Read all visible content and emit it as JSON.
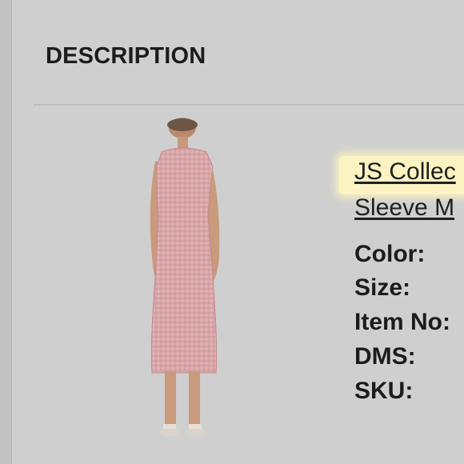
{
  "section": {
    "title": "DESCRIPTION"
  },
  "product": {
    "title_line1": "JS Collec",
    "title_line2": "Sleeve M",
    "image_alt": "pink sequin midi dress on model"
  },
  "attributes": {
    "color_label": "Color:",
    "size_label": "Size:",
    "item_no_label": "Item No:",
    "dms_label": "DMS:",
    "sku_label": "SKU:"
  },
  "colors": {
    "background": "#cfcfcf",
    "highlight": "#fbf3c2",
    "dress": "#d9a9ab"
  }
}
